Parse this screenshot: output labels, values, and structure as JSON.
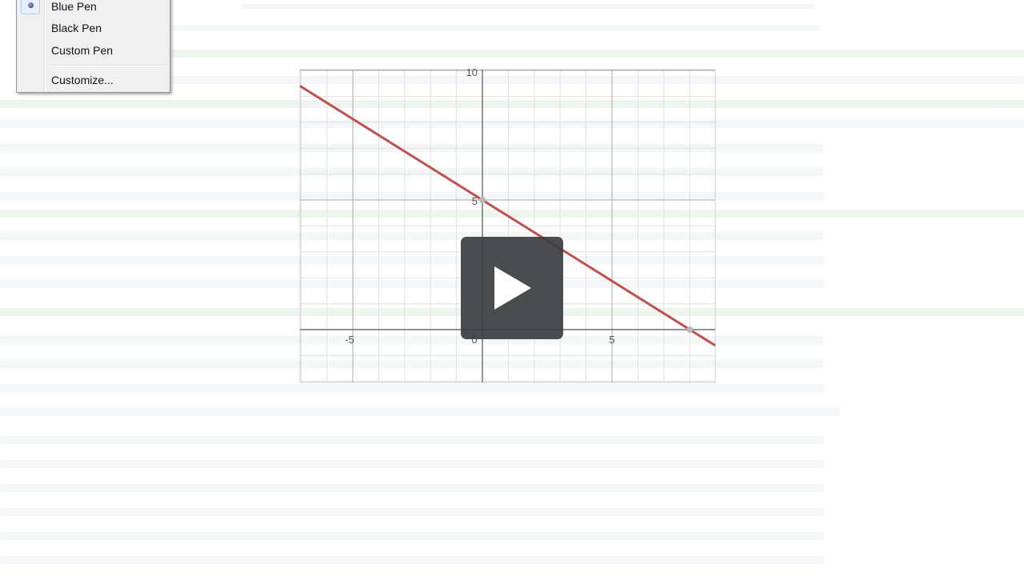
{
  "menu": {
    "items": [
      {
        "label": "Blue Pen",
        "selected": true
      },
      {
        "label": "Black Pen",
        "selected": false
      },
      {
        "label": "Custom Pen",
        "selected": false
      }
    ],
    "customize_label": "Customize..."
  },
  "graph": {
    "x_range": [
      -7,
      9
    ],
    "y_range": [
      -2,
      10
    ],
    "x_tick_labels": [
      "-5",
      "0",
      "5"
    ],
    "y_tick_labels": [
      "10",
      "5"
    ],
    "line_color": "#c0504d",
    "line": {
      "slope": -0.625,
      "intercept": 5
    },
    "points": [
      {
        "x": 0,
        "y": 5
      },
      {
        "x": 8,
        "y": 0
      }
    ]
  },
  "player": {
    "play_icon": "play-icon"
  }
}
